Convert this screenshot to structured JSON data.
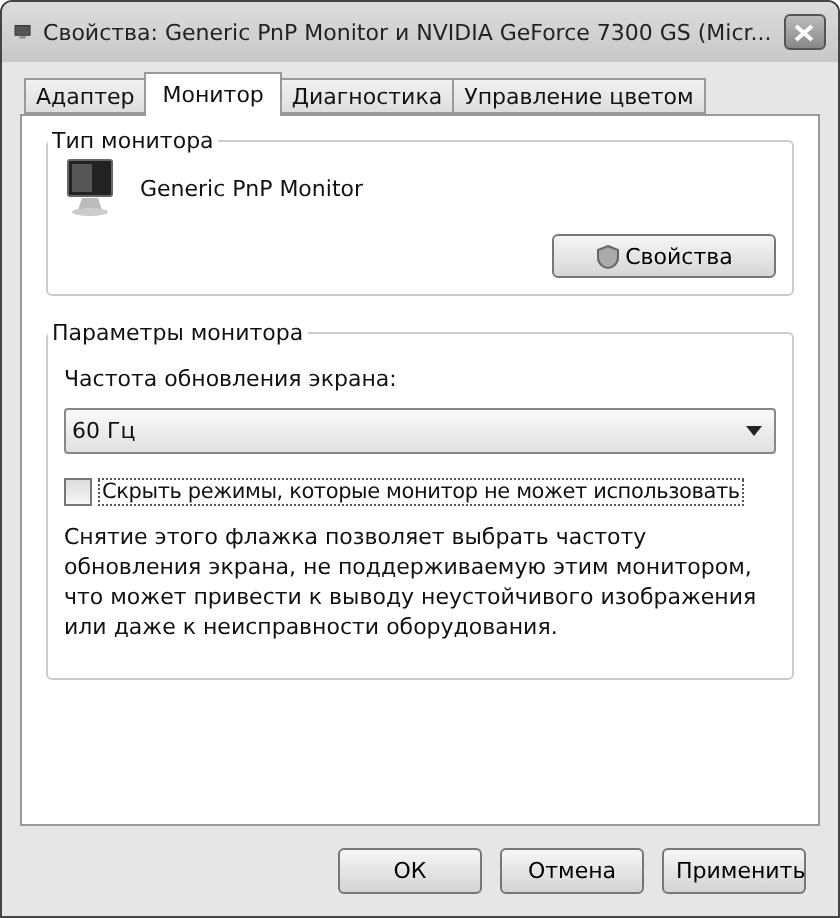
{
  "window": {
    "title": "Свойства: Generic PnP Monitor и NVIDIA GeForce 7300 GS (Micr..."
  },
  "tabs": [
    {
      "label": "Адаптер",
      "selected": false
    },
    {
      "label": "Монитор",
      "selected": true
    },
    {
      "label": "Диагностика",
      "selected": false
    },
    {
      "label": "Управление цветом",
      "selected": false
    }
  ],
  "monitor_type": {
    "title": "Тип монитора",
    "name": "Generic PnP Monitor",
    "button": "Свойства"
  },
  "monitor_settings": {
    "title": "Параметры монитора",
    "refresh_label": "Частота обновления экрана:",
    "refresh_value": "60 Гц",
    "hide_modes": {
      "label": "Скрыть режимы, которые монитор не может использовать",
      "checked": false
    },
    "note": "Снятие этого флажка позволяет выбрать частоту обновления экрана, не поддерживаемую этим монитором, что может привести к выводу неустойчивого изображения или даже к неисправности оборудования."
  },
  "buttons": [
    "ОК",
    "Отмена",
    "Применить"
  ]
}
